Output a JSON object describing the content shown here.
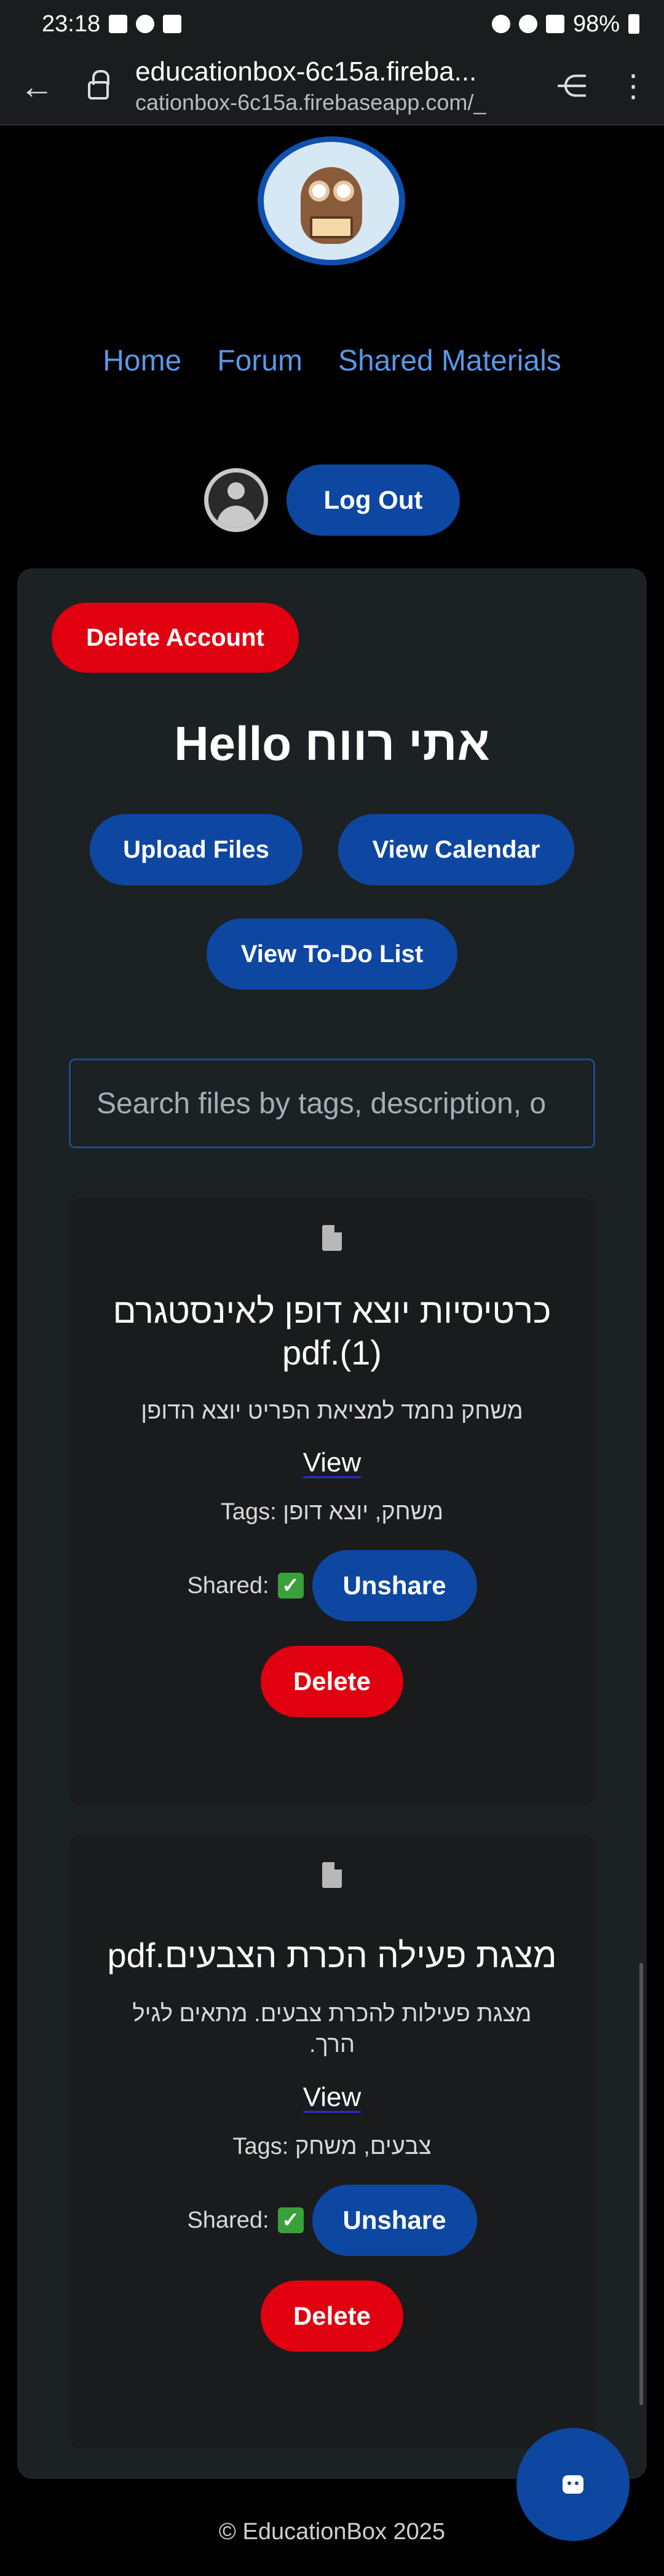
{
  "status_bar": {
    "time": "23:18",
    "battery": "98%"
  },
  "browser": {
    "title": "educationbox-6c15a.fireba...",
    "url": "cationbox-6c15a.firebaseapp.com/_"
  },
  "nav": {
    "home": "Home",
    "forum": "Forum",
    "shared": "Shared Materials"
  },
  "auth": {
    "logout": "Log Out"
  },
  "account": {
    "delete_label": "Delete Account"
  },
  "greeting": "Hello אתי רווח",
  "actions": {
    "upload": "Upload Files",
    "calendar": "View Calendar",
    "todo": "View To-Do List"
  },
  "search": {
    "placeholder": "Search files by tags, description, o"
  },
  "files": [
    {
      "name": "כרטיסיות יוצא דופן לאינסטגרם (1).pdf",
      "description": "משחק נחמד למציאת הפריט יוצא הדופן",
      "view": "View",
      "tags": "Tags: משחק, יוצא דופן",
      "shared_label": "Shared:",
      "unshare": "Unshare",
      "delete": "Delete"
    },
    {
      "name": "מצגת פעילה הכרת הצבעים.pdf",
      "description": "מצגת פעילות להכרת צבעים. מתאים לגיל הרך.",
      "view": "View",
      "tags": "Tags: צבעים, משחק",
      "shared_label": "Shared:",
      "unshare": "Unshare",
      "delete": "Delete"
    }
  ],
  "footer": "© EducationBox 2025",
  "icons": {
    "back": "back-arrow-icon",
    "lock": "lock-icon",
    "share": "share-icon",
    "menu": "more-vert-icon",
    "user": "user-avatar-icon",
    "pdf": "pdf-file-icon",
    "check": "check-mark-icon",
    "chat": "robot-chat-icon"
  },
  "colors": {
    "accent_blue": "#0d47a1",
    "danger_red": "#e00010",
    "link_blue": "#5a97e6",
    "card_bg": "#1c2124"
  }
}
